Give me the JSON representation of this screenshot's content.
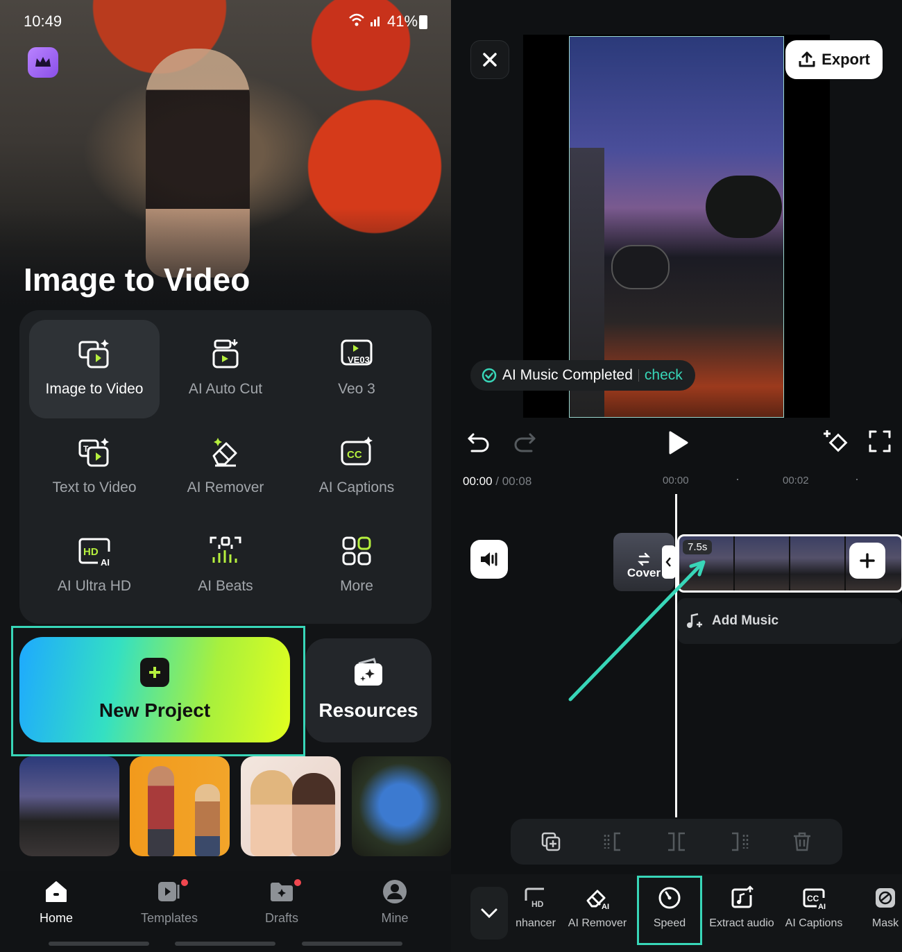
{
  "left": {
    "status": {
      "time": "10:49",
      "battery": "41%"
    },
    "hero_title": "Image to Video",
    "tools": [
      {
        "label": "Image to Video",
        "icon": "image-to-video-icon"
      },
      {
        "label": "AI Auto Cut",
        "icon": "ai-auto-cut-icon"
      },
      {
        "label": "Veo 3",
        "icon": "veo3-icon"
      },
      {
        "label": "Text to Video",
        "icon": "text-to-video-icon"
      },
      {
        "label": "AI Remover",
        "icon": "ai-remover-icon"
      },
      {
        "label": "AI Captions",
        "icon": "ai-captions-icon"
      },
      {
        "label": "AI Ultra HD",
        "icon": "ai-ultra-hd-icon"
      },
      {
        "label": "AI Beats",
        "icon": "ai-beats-icon"
      },
      {
        "label": "More",
        "icon": "more-grid-icon"
      }
    ],
    "new_project_label": "New Project",
    "resources_label": "Resources",
    "nav": [
      {
        "label": "Home"
      },
      {
        "label": "Templates"
      },
      {
        "label": "Drafts"
      },
      {
        "label": "Mine"
      }
    ]
  },
  "right": {
    "export_label": "Export",
    "toast": {
      "text": "AI Music Completed",
      "action": "check"
    },
    "time": {
      "current": "00:00",
      "total": "/ 00:08"
    },
    "ticks": [
      "00:00",
      "00:02"
    ],
    "cover_label": "Cover",
    "clip_duration": "7.5s",
    "add_music_label": "Add Music",
    "bottom_tools": [
      {
        "label": "nhancer"
      },
      {
        "label": "AI Remover"
      },
      {
        "label": "Speed"
      },
      {
        "label": "Extract audio"
      },
      {
        "label": "AI Captions"
      },
      {
        "label": "Mask"
      }
    ],
    "accent": "#38d6b8"
  }
}
